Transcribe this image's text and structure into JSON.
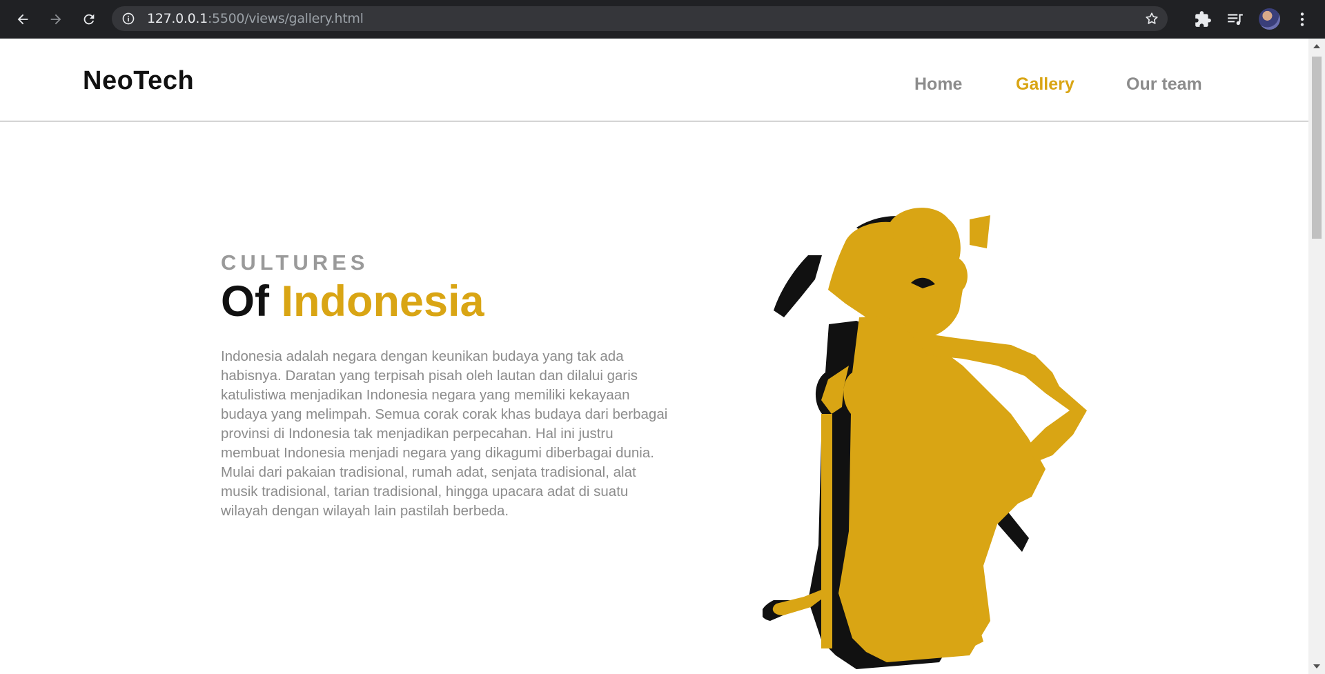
{
  "browser": {
    "url_host": "127.0.0.1",
    "url_path": ":5500/views/gallery.html",
    "icons": [
      "back-arrow-icon",
      "forward-arrow-icon",
      "reload-icon",
      "info-icon",
      "star-icon",
      "extensions-puzzle-icon",
      "media-queue-icon",
      "profile-avatar",
      "more-vert-icon"
    ]
  },
  "site": {
    "logo": "NeoTech",
    "nav": [
      {
        "label": "Home",
        "active": false
      },
      {
        "label": "Gallery",
        "active": true
      },
      {
        "label": "Our team",
        "active": false
      }
    ]
  },
  "hero": {
    "subtitle": "CULTURES",
    "title_prefix": "Of",
    "title_accent": "Indonesia",
    "body": "Indonesia adalah negara dengan keunikan budaya yang tak ada habisnya. Daratan yang terpisah pisah oleh lautan dan dilalui garis katulistiwa menjadikan Indonesia negara yang memiliki kekayaan budaya yang melimpah. Semua corak corak khas budaya dari berbagai provinsi di Indonesia tak menjadikan perpecahan. Hal ini justru membuat Indonesia menjadi negara yang dikagumi diberbagai dunia. Mulai dari pakaian tradisional, rumah adat, senjata tradisional, alat musik tradisional, tarian tradisional, hingga upacara adat di suatu wilayah dengan wilayah lain pastilah berbeda."
  },
  "colors": {
    "accent": "#d9a514",
    "nav_inactive": "#8c8c8c",
    "text_dark": "#111111",
    "body_text": "#8c8c8c",
    "chrome_bg": "#202124"
  }
}
